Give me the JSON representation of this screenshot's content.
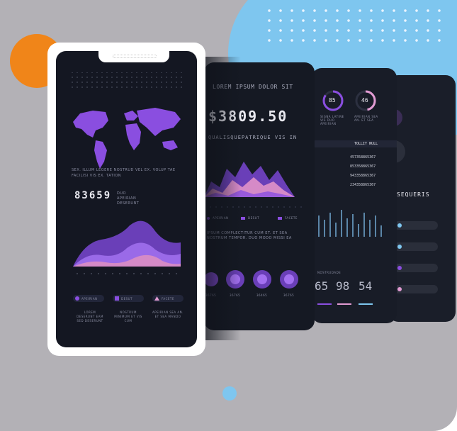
{
  "phone": {
    "caption": "SEX. ILLUM LEGERE NOSTRUD VEL EX. VOLUP TAE FACILISI VIS EX. TATION",
    "stat_value": "83659",
    "stat_label": "DUO APEIRIAN DESERUNT",
    "legend": [
      {
        "label": "APEIRIAN",
        "shape": "circle"
      },
      {
        "label": "DESUT",
        "shape": "square"
      },
      {
        "label": "FACETE",
        "shape": "triangle"
      }
    ],
    "footnotes": [
      "LOREM DESERUNT EAM SED DESERUNT",
      "NOSTRUM MINIMUM ET VIS CUM",
      "APEIRIAN SEA AN. ET SEA MANDO"
    ]
  },
  "card2": {
    "heading": "LOREM IPSUM DOLOR SIT",
    "amount": "$3809.50",
    "subheading": "QUALISQUEPATRIQUE VIS IN",
    "legend": [
      "APEIRIAN",
      "DESUT",
      "FACETE"
    ],
    "body": "IPSUM COMPLECTITUR CUM ET. ET SEA NOSTRUM TEMPOR. DUO MODO MISSI EA",
    "rings": [
      "36765",
      "36765",
      "36465",
      "36765"
    ]
  },
  "card3": {
    "donuts": [
      {
        "value": "85",
        "label": "SIGNA LATINE VIS DUO APEIRIAN"
      },
      {
        "value": "46",
        "label": "APEIRIAN SEA AN. ET SEA"
      }
    ],
    "table_header": "TOLLIT NULL",
    "table_rows": [
      "457358865367",
      "853358865367",
      "943358865367",
      "234358865367"
    ],
    "big_numbers": [
      "65",
      "98",
      "54"
    ],
    "section_label": "NOSTRUDADE"
  },
  "card4": {
    "heading": "SEQUERIS"
  },
  "colors": {
    "accent_purple": "#8a4ee0",
    "pink": "#e29bd3",
    "orange": "#f08519",
    "sky_blue": "#7ec6ef",
    "dark": "#141722"
  }
}
